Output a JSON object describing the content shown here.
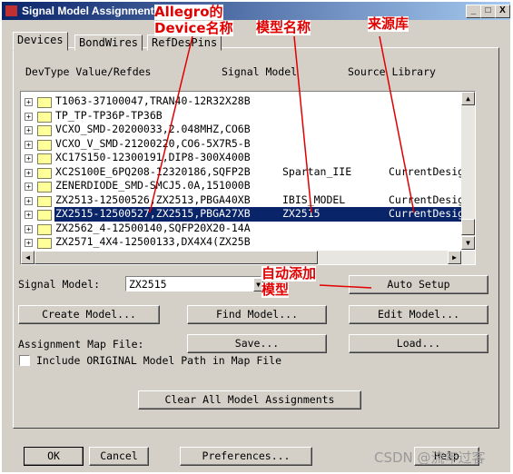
{
  "window": {
    "title": "Signal Model Assignment",
    "controls": [
      "_",
      "□",
      "X"
    ]
  },
  "tabs": [
    {
      "label": "Devices",
      "active": true
    },
    {
      "label": "BondWires"
    },
    {
      "label": "RefDesPins"
    }
  ],
  "columns": {
    "device": "DevType Value/Refdes",
    "model": "Signal Model",
    "source": "Source Library"
  },
  "rows": [
    {
      "device": "T1063-37100047,TRAN40-12R32X28B",
      "model": "",
      "source": ""
    },
    {
      "device": "TP_TP-TP36P-TP36B",
      "model": "",
      "source": ""
    },
    {
      "device": "VCXO_SMD-20200033,2.048MHZ,CO6B",
      "model": "",
      "source": ""
    },
    {
      "device": "VCXO_V_SMD-21200220,CO6-5X7R5-B",
      "model": "",
      "source": ""
    },
    {
      "device": "XC17S150-12300191,DIP8-300X400B",
      "model": "",
      "source": ""
    },
    {
      "device": "XC2S100E_6PQ208-12320186,SQFP2B",
      "model": "Spartan_IIE",
      "source": "CurrentDesig"
    },
    {
      "device": "ZENERDIODE_SMD-SMCJ5.0A,151000B",
      "model": "",
      "source": ""
    },
    {
      "device": "ZX2513-12500526,ZX2513,PBGA40XB",
      "model": "IBIS_MODEL",
      "source": "CurrentDesig"
    },
    {
      "device": "ZX2515-12500527,ZX2515,PBGA27XB",
      "model": "ZX2515",
      "source": "CurrentDesig",
      "selected": true
    },
    {
      "device": "ZX2562_4-12500140,SQFP20X20-14A",
      "model": "",
      "source": ""
    },
    {
      "device": "ZX2571_4X4-12500133,DX4X4(ZX25B",
      "model": "",
      "source": ""
    }
  ],
  "signal_model": {
    "label": "Signal Model:",
    "value": "ZX2515"
  },
  "buttons": {
    "auto_setup": "Auto Setup",
    "create": "Create Model...",
    "find": "Find Model...",
    "edit": "Edit Model...",
    "save": "Save...",
    "load": "Load...",
    "clear": "Clear All Model Assignments",
    "ok": "OK",
    "cancel": "Cancel",
    "preferences": "Preferences...",
    "help": "Help"
  },
  "map_file_label": "Assignment Map File:",
  "include_checkbox": {
    "label": "Include ORIGINAL Model Path in Map File",
    "checked": false
  },
  "annotations": {
    "device_line1": "Allegro的",
    "device_line2": "Device名称",
    "model": "模型名称",
    "source": "来源库",
    "auto1": "自动添加",
    "auto2": "模型",
    "color": "#e00000"
  },
  "watermark": "CSDN @流年过客"
}
